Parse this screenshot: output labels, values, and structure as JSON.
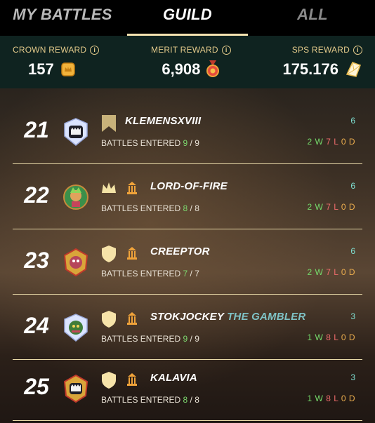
{
  "tabs": [
    {
      "label": "MY BATTLES",
      "active": false
    },
    {
      "label": "GUILD",
      "active": true
    },
    {
      "label": "ALL",
      "active": false
    }
  ],
  "rewards": {
    "crown": {
      "label": "CROWN REWARD",
      "value": "157",
      "icon": "crown-token-icon"
    },
    "merit": {
      "label": "MERIT REWARD",
      "value": "6,908",
      "icon": "merit-medal-icon"
    },
    "sps": {
      "label": "SPS REWARD",
      "value": "175.176",
      "icon": "sps-crystal-icon"
    }
  },
  "battles_label": "BATTLES ENTERED",
  "rows": [
    {
      "rank": "21",
      "name": "KLEMENSXVIII",
      "suffix": "",
      "badge": "banner",
      "title_icon": false,
      "entered": "9",
      "total": "9",
      "score": "6",
      "w": "2 W",
      "l": "7 L",
      "d": "0 D"
    },
    {
      "rank": "22",
      "name": "LORD-OF-FIRE",
      "suffix": "",
      "badge": "crown",
      "title_icon": true,
      "entered": "8",
      "total": "8",
      "score": "6",
      "w": "2 W",
      "l": "7 L",
      "d": "0 D"
    },
    {
      "rank": "23",
      "name": "CREEPTOR",
      "suffix": "",
      "badge": "shield",
      "title_icon": true,
      "entered": "7",
      "total": "7",
      "score": "6",
      "w": "2 W",
      "l": "7 L",
      "d": "0 D"
    },
    {
      "rank": "24",
      "name": "STOKJOCKEY",
      "suffix": "THE GAMBLER",
      "badge": "shield",
      "title_icon": true,
      "entered": "9",
      "total": "9",
      "score": "3",
      "w": "1 W",
      "l": "8 L",
      "d": "0 D"
    },
    {
      "rank": "25",
      "name": "KALAVIA",
      "suffix": "",
      "badge": "shield",
      "title_icon": true,
      "entered": "8",
      "total": "8",
      "score": "3",
      "w": "1 W",
      "l": "8 L",
      "d": "0 D"
    }
  ],
  "colors": {
    "accent": "#f4e2b0",
    "reward_label": "#e2c98a",
    "wins": "#74d86a",
    "losses": "#ef6c6c",
    "draws": "#ecae4e",
    "score": "#7fe0d2"
  }
}
